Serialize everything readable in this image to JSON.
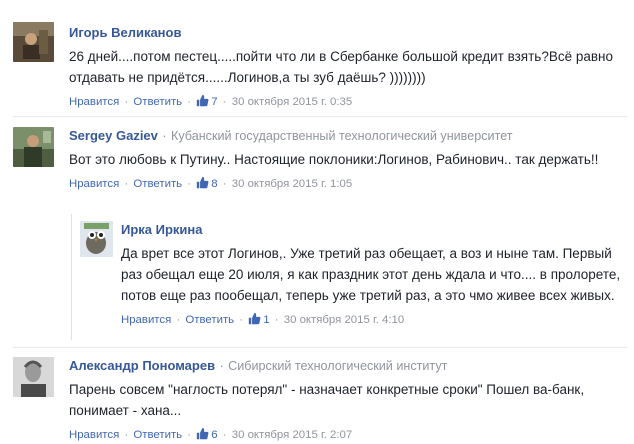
{
  "comments": [
    {
      "author": "Игорь Великанов",
      "affiliation": "",
      "text": "26 дней....потом пестец.....пойти что ли в Сбербанке большой кредит взять?Всё равно отдавать не придётся......Логинов,а ты зуб даёшь? ))))))))",
      "like_label": "Нравится",
      "reply_label": "Ответить",
      "likes": "7",
      "timestamp": "30 октября 2015 г. 0:35"
    },
    {
      "author": "Sergey Gaziev",
      "affiliation": "Кубанский государственный технологический университет",
      "text": "Вот это любовь к Путину.. Настоящие поклоники:Логинов, Рабинович.. так держать!!",
      "like_label": "Нравится",
      "reply_label": "Ответить",
      "likes": "8",
      "timestamp": "30 октября 2015 г. 1:05"
    },
    {
      "author": "Ирка Иркина",
      "affiliation": "",
      "text": "Да врет все этот Логинов,. Уже третий раз обещает, а воз и ныне там. Первый раз обещал еще 20 июля, я как праздник этот день ждала и что.... в пролорете, потов еще раз пообещал, теперь уже третий раз, а это чмо живее всех живых.",
      "like_label": "Нравится",
      "reply_label": "Ответить",
      "likes": "1",
      "timestamp": "30 октября 2015 г. 4:10"
    },
    {
      "author": "Александр Пономарев",
      "affiliation": "Сибирский технологический институт",
      "text": "Парень совсем \"наглость потерял\" - назначает конкретные сроки\" Пошел ва-банк, понимает - хана...",
      "like_label": "Нравится",
      "reply_label": "Ответить",
      "likes": "6",
      "timestamp": "30 октября 2015 г. 2:07"
    }
  ],
  "separators": {
    "dot": "·"
  },
  "colors": {
    "link": "#4267b2",
    "author": "#365899",
    "meta": "#90949c",
    "text": "#1d2129"
  }
}
